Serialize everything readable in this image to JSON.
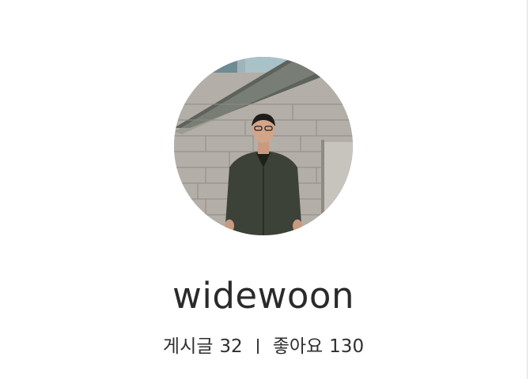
{
  "profile": {
    "username": "widewoon",
    "posts_label": "게시글",
    "posts_count": "32",
    "likes_label": "좋아요",
    "likes_count": "130"
  }
}
